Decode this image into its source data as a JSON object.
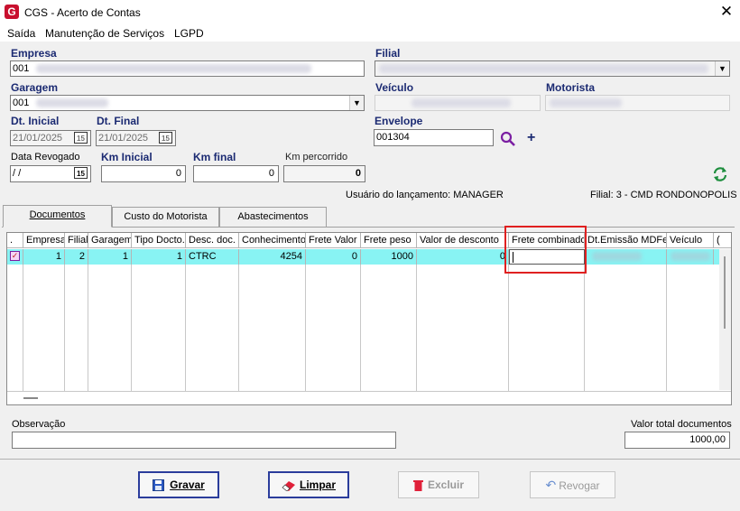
{
  "window": {
    "title": "CGS - Acerto de Contas",
    "app_icon": "G"
  },
  "menu": [
    "Saída",
    "Manutenção de Serviços",
    "LGPD"
  ],
  "labels": {
    "empresa": "Empresa",
    "filial": "Filial",
    "garagem": "Garagem",
    "veiculo": "Veículo",
    "motorista": "Motorista",
    "dt_inicial": "Dt. Inicial",
    "dt_final": "Dt. Final",
    "envelope": "Envelope",
    "data_revogado": "Data Revogado",
    "km_inicial": "Km Inicial",
    "km_final": "Km final",
    "km_percorrido": "Km percorrido",
    "observacao": "Observação",
    "valor_total": "Valor total documentos"
  },
  "fields": {
    "empresa": "001",
    "garagem": "001",
    "dt_inicial": "21/01/2025",
    "dt_final": "21/01/2025",
    "envelope": "001304",
    "data_revogado": " / /",
    "km_inicial": "0",
    "km_final": "0",
    "km_percorrido": "0",
    "valor_total": "1000,00",
    "observacao": "",
    "calendar_label": "15"
  },
  "info": {
    "usuario": "Usuário do lançamento: MANAGER",
    "filial": "Filial: 3 - CMD RONDONOPOLIS"
  },
  "tabs": [
    "Documentos",
    "Custo do Motorista",
    "Abastecimentos"
  ],
  "grid": {
    "headers": [
      ".",
      "Empresa",
      "Filial",
      "Garagem",
      "Tipo Docto.",
      "Desc. doc.",
      "Conhecimento",
      "Frete Valor",
      "Frete peso",
      "Valor de desconto",
      "Frete combinado",
      "Dt.Emissão MDFe",
      "Veículo",
      "("
    ],
    "row": [
      "",
      "1",
      "2",
      "1",
      "1",
      "CTRC",
      "4254",
      "0",
      "1000",
      "0",
      "",
      "",
      "",
      ""
    ]
  },
  "buttons": {
    "gravar": "Gravar",
    "limpar": "Limpar",
    "excluir": "Excluir",
    "revogar": "Revogar"
  },
  "colors": {
    "row_highlight": "#88f3f3",
    "label_blue": "#1b2a72",
    "highlight_box": "#e02020",
    "brand": "#c8102e"
  }
}
